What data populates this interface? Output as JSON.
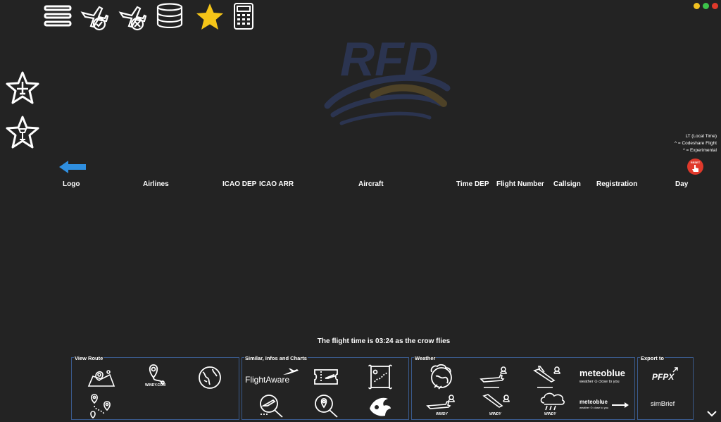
{
  "toolbar": {
    "icons": [
      "menu-icon",
      "flight-confirm-icon",
      "flight-cancel-icon",
      "database-icon",
      "favorite-star-icon",
      "calculator-icon"
    ]
  },
  "watermark": {
    "text": "RFD"
  },
  "sidebar": {
    "items": [
      "favorite-airline-icon",
      "favorite-airport-icon"
    ]
  },
  "legend": {
    "line1": "LT (Local Time)",
    "line2": "^ = Codeshare Flight",
    "line3": "* = Experimental"
  },
  "reset_button": {
    "label": "RESET"
  },
  "table": {
    "columns": [
      "Logo",
      "Airlines",
      "ICAO DEP",
      "ICAO ARR",
      "Aircraft",
      "Time DEP",
      "Flight Number",
      "Callsign",
      "Registration",
      "Day"
    ]
  },
  "flight_time": "The flight time is 03:24 as the crow flies",
  "panels": {
    "view_route": {
      "title": "View Route",
      "windy_label": "WINDY.COM"
    },
    "similar": {
      "title": "Similar, Infos and Charts",
      "flightaware_label": "FlightAware"
    },
    "weather": {
      "title": "Weather",
      "windy_label": "WINDY",
      "meteoblue_label": "meteoblue",
      "meteoblue_tagline": "weather ⊙ close to you"
    },
    "export": {
      "title": "Export to",
      "pfpx_label": "PFPX",
      "simbrief_label": "simBrief"
    }
  },
  "colors": {
    "background": "#232323",
    "accent_blue": "#2f8fe0",
    "star": "#f5c518",
    "reset_red": "#e0392b",
    "panel_border": "#3a5a8c"
  }
}
